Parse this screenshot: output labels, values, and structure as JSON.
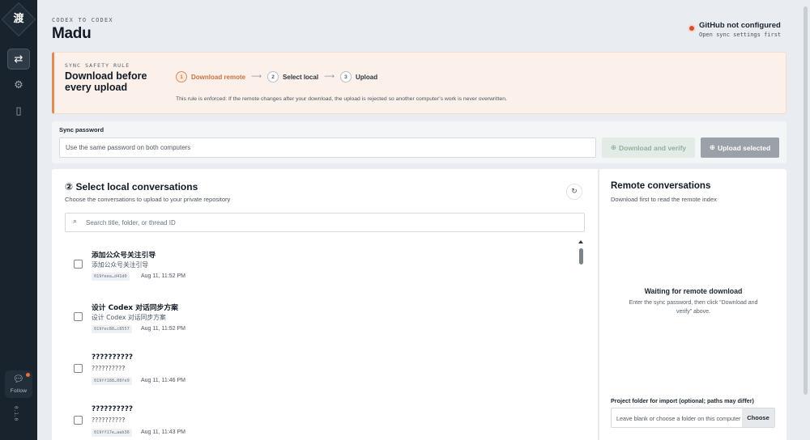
{
  "rail": {
    "logo_glyph": "渡",
    "follow_label": "Follow",
    "version": "0.1.0"
  },
  "header": {
    "eyebrow": "CODEX TO CODEX",
    "title": "Madu",
    "status_title": "GitHub not configured",
    "status_sub": "Open sync settings first",
    "status_color": "#d24e2e"
  },
  "rule": {
    "eyebrow": "SYNC SAFETY RULE",
    "title": "Download before every upload",
    "steps": [
      {
        "num": "1",
        "label": "Download remote"
      },
      {
        "num": "2",
        "label": "Select local"
      },
      {
        "num": "3",
        "label": "Upload"
      }
    ],
    "note": "This rule is enforced: If the remote changes after your download, the upload is rejected so another computer’s work is never overwritten.",
    "accent": "#e08a5a"
  },
  "password": {
    "label": "Sync password",
    "placeholder": "Use the same password on both computers",
    "download_button": "Download and verify",
    "upload_button": "Upload selected"
  },
  "local": {
    "title": "Select local conversations",
    "subtitle": "Choose the conversations to upload to your private repository",
    "search_placeholder": "Search title, folder, or thread ID",
    "items": [
      {
        "title": "添加公众号关注引导",
        "subtitle": "添加公众号关注引导",
        "id": "019feea…d41d0",
        "time": "Aug 11, 11:52 PM"
      },
      {
        "title": "设计 Codex 对话同步方案",
        "subtitle": "设计 Codex 对话同步方案",
        "id": "019fec80…c8557",
        "time": "Aug 11, 11:52 PM"
      },
      {
        "title": "??????????",
        "subtitle": "??????????",
        "id": "019ff188…08fe9",
        "time": "Aug 11, 11:46 PM"
      },
      {
        "title": "??????????",
        "subtitle": "??????????",
        "id": "019ff17e…aab36",
        "time": "Aug 11, 11:43 PM"
      }
    ]
  },
  "remote": {
    "title": "Remote conversations",
    "subtitle": "Download first to read the remote index",
    "waiting_title": "Waiting for remote download",
    "waiting_text": "Enter the sync password, then click “Download and verify” above.",
    "project_label": "Project folder for import (optional; paths may differ)",
    "project_placeholder": "Leave blank or choose a folder on this computer",
    "choose_button": "Choose"
  }
}
